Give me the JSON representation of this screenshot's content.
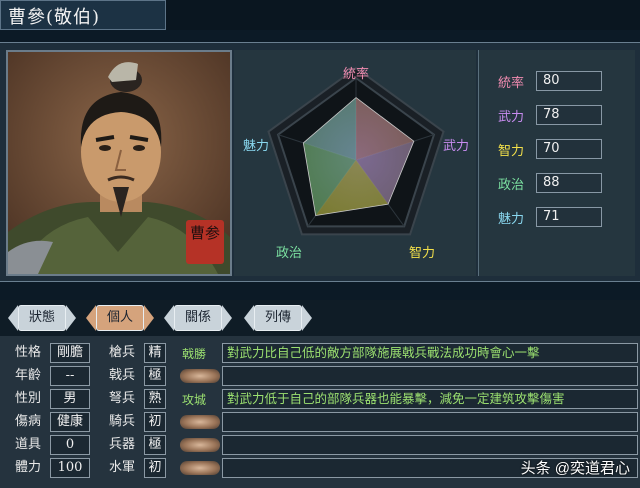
{
  "header": {
    "name": "曹參(敬伯)"
  },
  "portrait": {
    "seal_text": "曹参"
  },
  "radar": {
    "labels": {
      "tongshuai": "統率",
      "wuli": "武力",
      "zhili": "智力",
      "zhengzhi": "政治",
      "meili": "魅力"
    },
    "label_colors": {
      "tongshuai": "#f08bb0",
      "wuli": "#c88cf0",
      "zhili": "#f3e04a",
      "zhengzhi": "#7be0a0",
      "meili": "#8ad8f0"
    },
    "values": {
      "tongshuai": 80,
      "wuli": 78,
      "zhili": 70,
      "zhengzhi": 88,
      "meili": 71
    },
    "max": 100
  },
  "stats": [
    {
      "label": "統率",
      "value": "80",
      "color": "#f08bb0"
    },
    {
      "label": "武力",
      "value": "78",
      "color": "#c88cf0"
    },
    {
      "label": "智力",
      "value": "70",
      "color": "#f3e04a"
    },
    {
      "label": "政治",
      "value": "88",
      "color": "#7be0a0"
    },
    {
      "label": "魅力",
      "value": "71",
      "color": "#8ad8f0"
    }
  ],
  "tabs": [
    {
      "label": "狀態",
      "active": false
    },
    {
      "label": "個人",
      "active": true
    },
    {
      "label": "關係",
      "active": false
    },
    {
      "label": "列傳",
      "active": false
    }
  ],
  "personal": [
    {
      "label": "性格",
      "value": "剛膽"
    },
    {
      "label": "年齡",
      "value": "--"
    },
    {
      "label": "性別",
      "value": "男"
    },
    {
      "label": "傷病",
      "value": "健康"
    },
    {
      "label": "道具",
      "value": "0"
    },
    {
      "label": "體力",
      "value": "100"
    }
  ],
  "aptitude": [
    {
      "label": "槍兵",
      "value": "精"
    },
    {
      "label": "戟兵",
      "value": "極"
    },
    {
      "label": "弩兵",
      "value": "熟"
    },
    {
      "label": "騎兵",
      "value": "初"
    },
    {
      "label": "兵器",
      "value": "極"
    },
    {
      "label": "水軍",
      "value": "初"
    }
  ],
  "skills": [
    {
      "tag": "戟勝",
      "desc": "對武力比自己低的敵方部隊施展戟兵戰法成功時會心一擊"
    },
    {
      "tag": "",
      "desc": ""
    },
    {
      "tag": "攻城",
      "desc": "對武力低于自己的部隊兵器也能暴擊，減免一定建筑攻擊傷害"
    },
    {
      "tag": "",
      "desc": ""
    },
    {
      "tag": "",
      "desc": ""
    },
    {
      "tag": "",
      "desc": ""
    }
  ],
  "watermark": "头条 @奕道君心"
}
